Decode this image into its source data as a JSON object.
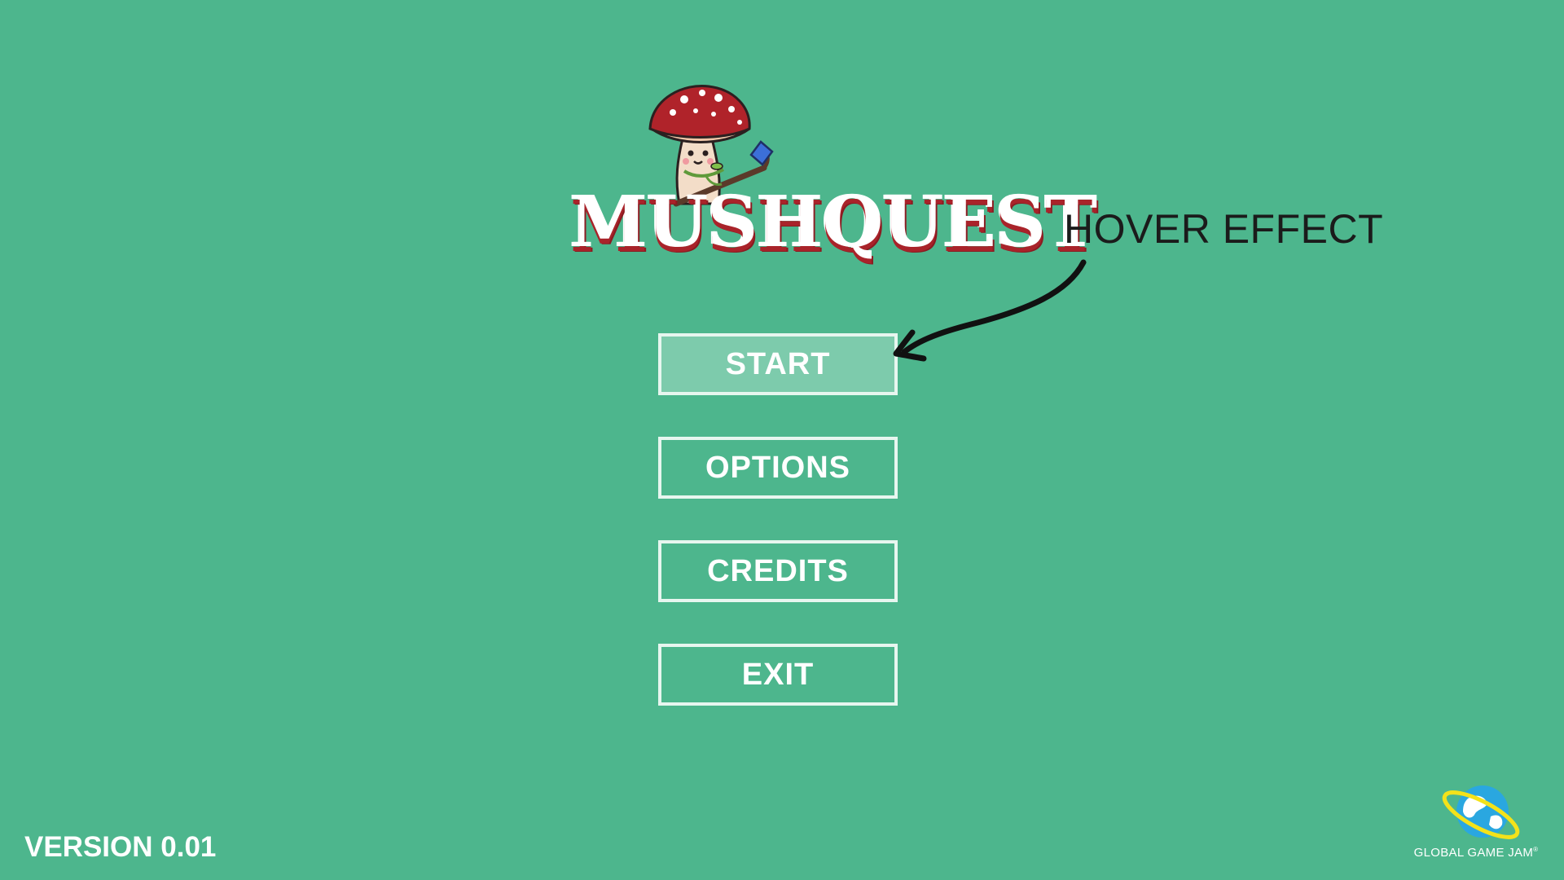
{
  "game": {
    "title": "MUSHQUEST",
    "version": "VERSION 0.01"
  },
  "menu": {
    "items": [
      {
        "label": "START",
        "state": "hover"
      },
      {
        "label": "OPTIONS"
      },
      {
        "label": "CREDITS"
      },
      {
        "label": "EXIT"
      }
    ]
  },
  "annotation": {
    "label": "HOVER EFFECT"
  },
  "sponsor": {
    "label": "GLOBAL GAME JAM",
    "registered_mark": "®"
  },
  "icons": {
    "mascot": "mushroom-mascot-icon",
    "arrow": "hand-drawn-arrow-icon",
    "sponsor": "global-game-jam-globe-icon"
  },
  "colors": {
    "background": "#4db68d",
    "button_border": "#e7f6ef",
    "button_hover_fill": "#7dcbac",
    "title_shadow": "#a9232a",
    "mushroom_cap": "#b0232a",
    "ggj_blue": "#2aa7e0",
    "ggj_yellow": "#f4e21a"
  }
}
